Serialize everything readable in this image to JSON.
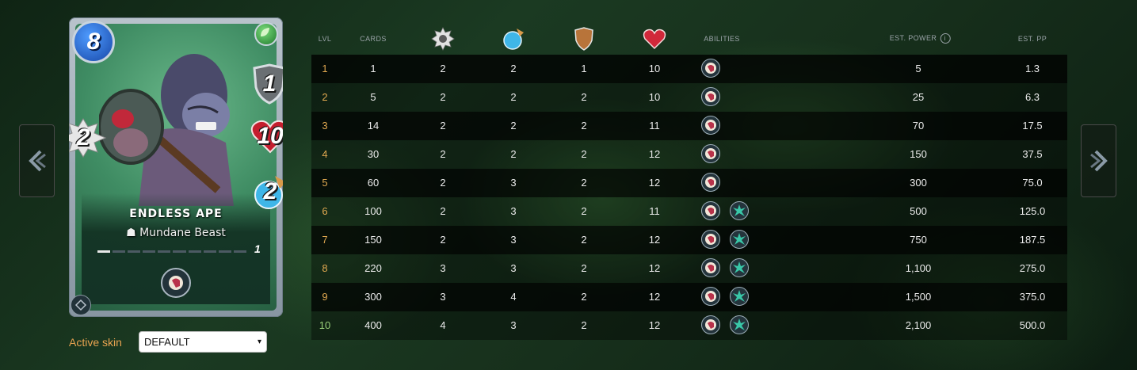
{
  "card": {
    "name": "ENDLESS APE",
    "type": "Mundane Beast",
    "mana": "8",
    "armor": "1",
    "health": "10",
    "speed": "2",
    "attack": "2",
    "level": "1",
    "element_icon": "leaf-icon",
    "ability_icon": "head-profile-icon",
    "frame_color": "#8795a1",
    "background_color": "#3f8c63"
  },
  "skin": {
    "label": "Active skin",
    "selected": "DEFAULT"
  },
  "table": {
    "headers": {
      "lvl": "LVL",
      "cards": "CARDS",
      "attack_icon": "sawblade-icon",
      "speed_icon": "speed-orb-icon",
      "armor_icon": "shield-icon",
      "health_icon": "heart-icon",
      "abilities": "ABILITIES",
      "est_power": "EST. POWER",
      "est_pp": "EST. PP"
    },
    "rows": [
      {
        "lvl": "1",
        "cards": "1",
        "attack": "2",
        "speed": "2",
        "armor": "1",
        "health": "10",
        "abilities": [
          "head-profile-icon"
        ],
        "est_power": "5",
        "est_pp": "1.3"
      },
      {
        "lvl": "2",
        "cards": "5",
        "attack": "2",
        "speed": "2",
        "armor": "2",
        "health": "10",
        "abilities": [
          "head-profile-icon"
        ],
        "est_power": "25",
        "est_pp": "6.3"
      },
      {
        "lvl": "3",
        "cards": "14",
        "attack": "2",
        "speed": "2",
        "armor": "2",
        "health": "11",
        "abilities": [
          "head-profile-icon"
        ],
        "est_power": "70",
        "est_pp": "17.5"
      },
      {
        "lvl": "4",
        "cards": "30",
        "attack": "2",
        "speed": "2",
        "armor": "2",
        "health": "12",
        "abilities": [
          "head-profile-icon"
        ],
        "est_power": "150",
        "est_pp": "37.5"
      },
      {
        "lvl": "5",
        "cards": "60",
        "attack": "2",
        "speed": "3",
        "armor": "2",
        "health": "12",
        "abilities": [
          "head-profile-icon"
        ],
        "est_power": "300",
        "est_pp": "75.0"
      },
      {
        "lvl": "6",
        "cards": "100",
        "attack": "2",
        "speed": "3",
        "armor": "2",
        "health": "11",
        "abilities": [
          "head-profile-icon",
          "green-burst-icon"
        ],
        "est_power": "500",
        "est_pp": "125.0"
      },
      {
        "lvl": "7",
        "cards": "150",
        "attack": "2",
        "speed": "3",
        "armor": "2",
        "health": "12",
        "abilities": [
          "head-profile-icon",
          "green-burst-icon"
        ],
        "est_power": "750",
        "est_pp": "187.5"
      },
      {
        "lvl": "8",
        "cards": "220",
        "attack": "3",
        "speed": "3",
        "armor": "2",
        "health": "12",
        "abilities": [
          "head-profile-icon",
          "green-burst-icon"
        ],
        "est_power": "1,100",
        "est_pp": "275.0"
      },
      {
        "lvl": "9",
        "cards": "300",
        "attack": "3",
        "speed": "4",
        "armor": "2",
        "health": "12",
        "abilities": [
          "head-profile-icon",
          "green-burst-icon"
        ],
        "est_power": "1,500",
        "est_pp": "375.0"
      },
      {
        "lvl": "10",
        "cards": "400",
        "attack": "4",
        "speed": "3",
        "armor": "2",
        "health": "12",
        "abilities": [
          "head-profile-icon",
          "green-burst-icon"
        ],
        "est_power": "2,100",
        "est_pp": "500.0"
      }
    ]
  },
  "nav": {
    "prev_icon": "chevron-left-icon",
    "next_icon": "chevron-right-icon"
  }
}
